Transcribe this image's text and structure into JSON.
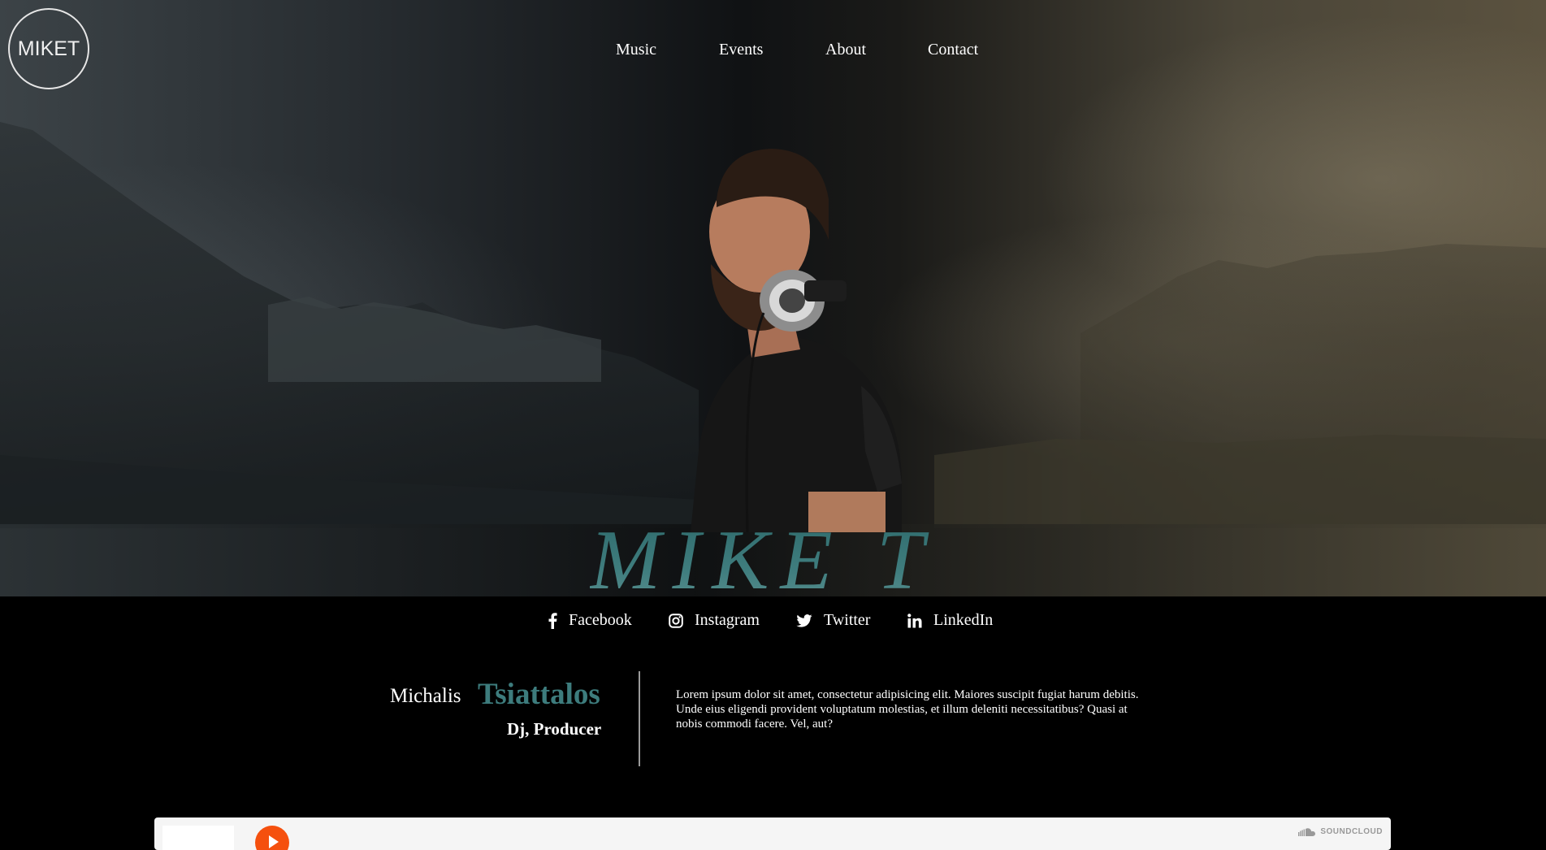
{
  "brand": {
    "logo_text": "MIKET"
  },
  "nav": {
    "items": [
      {
        "label": "Music"
      },
      {
        "label": "Events"
      },
      {
        "label": "About"
      },
      {
        "label": "Contact"
      }
    ]
  },
  "hero": {
    "stage_name": "MIKE T"
  },
  "social": {
    "items": [
      {
        "label": "Facebook",
        "icon": "facebook-icon"
      },
      {
        "label": "Instagram",
        "icon": "instagram-icon"
      },
      {
        "label": "Twitter",
        "icon": "twitter-icon"
      },
      {
        "label": "LinkedIn",
        "icon": "linkedin-icon"
      }
    ]
  },
  "bio": {
    "first_name": "Michalis",
    "last_name": "Tsiattalos",
    "role": "Dj, Producer",
    "text": "Lorem ipsum dolor sit amet, consectetur adipisicing elit. Maiores suscipit fugiat harum debitis. Unde eius eligendi provident voluptatum molestias, et illum deleniti necessitatibus? Quasi at nobis commodi facere. Vel, aut?"
  },
  "player": {
    "brand": "SOUNDCLOUD",
    "icon": "soundcloud-icon"
  },
  "colors": {
    "accent_teal": "#3d7c7d",
    "play_orange": "#f5500e"
  }
}
